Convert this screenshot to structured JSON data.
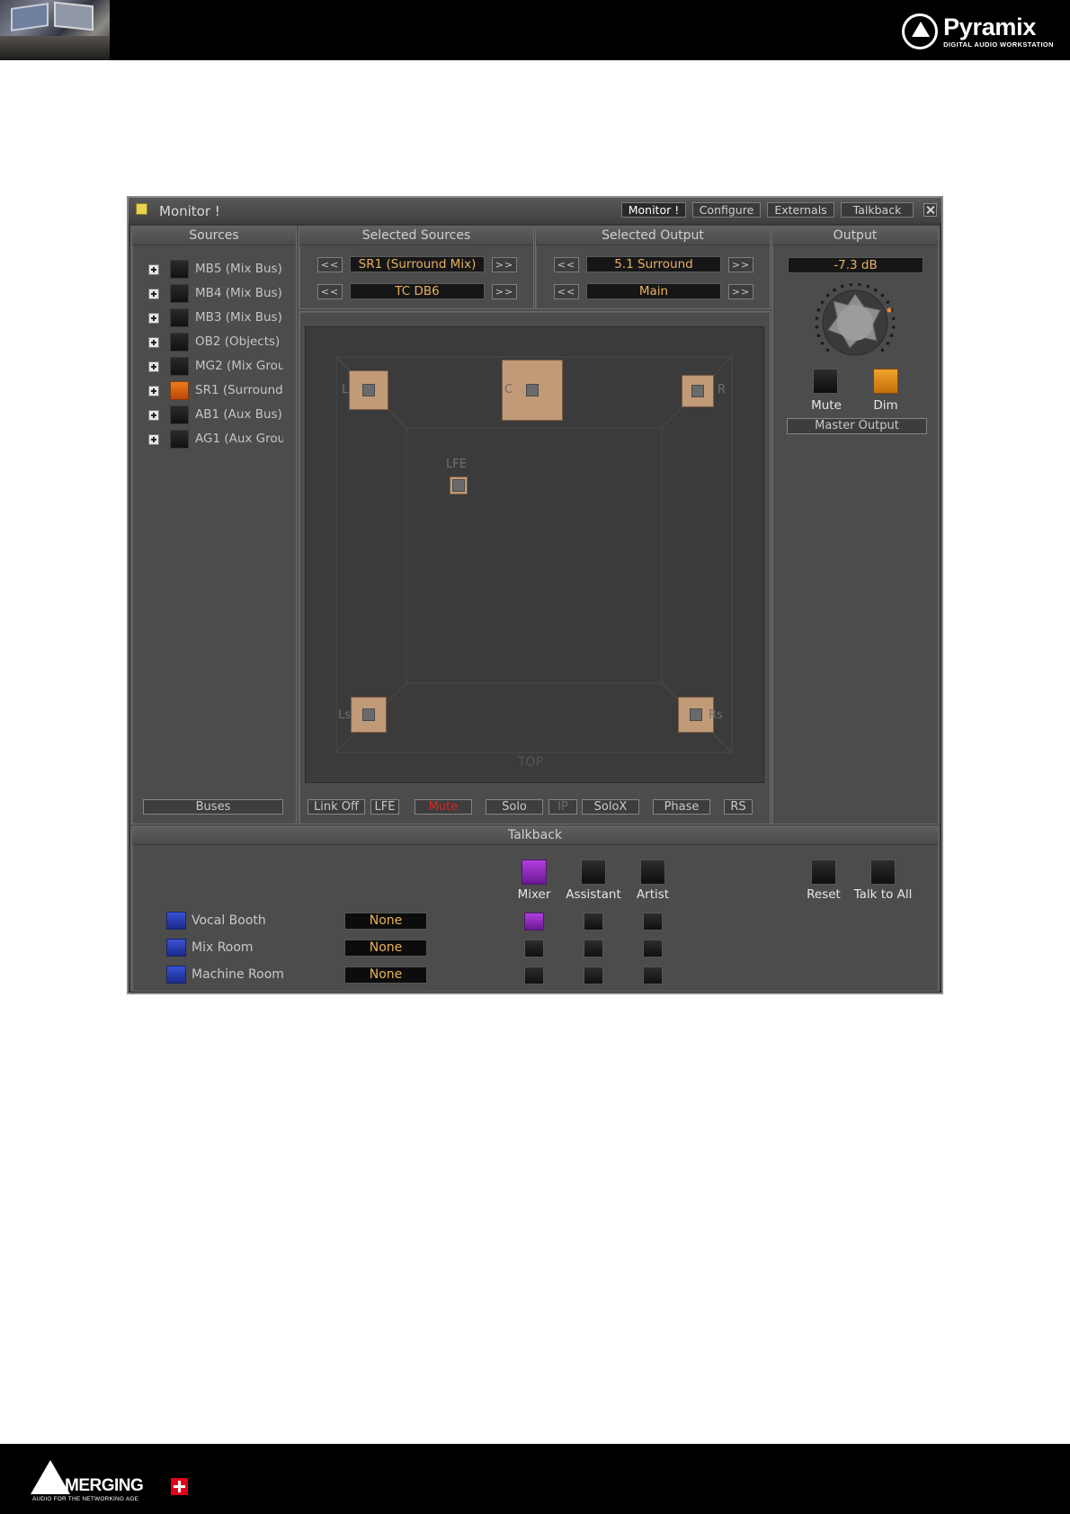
{
  "page": {
    "brand_name": "Pyramix",
    "brand_tagline": "DIGITAL AUDIO WORKSTATION",
    "footer_name": "MERGING",
    "footer_tagline": "AUDIO FOR THE NETWORKING AGE"
  },
  "window": {
    "title": "Monitor !",
    "tabs": [
      "Monitor !",
      "Configure",
      "Externals",
      "Talkback"
    ]
  },
  "sources": {
    "title": "Sources",
    "items": [
      {
        "label": "MB5 (Mix Bus)",
        "active": false
      },
      {
        "label": "MB4 (Mix Bus)",
        "active": false
      },
      {
        "label": "MB3 (Mix Bus)",
        "active": false
      },
      {
        "label": "OB2 (Objects)",
        "active": false
      },
      {
        "label": "MG2 (Mix Grou",
        "active": false
      },
      {
        "label": "SR1 (Surround",
        "active": true
      },
      {
        "label": "AB1 (Aux Bus)",
        "active": false
      },
      {
        "label": "AG1 (Aux Grou",
        "active": false
      }
    ],
    "buses_button": "Buses"
  },
  "selected_sources": {
    "title": "Selected Sources",
    "source": "SR1 (Surround Mix)",
    "secondary": "TC DB6",
    "prev": "<<",
    "next": ">>"
  },
  "selected_output": {
    "title": "Selected Output",
    "format": "5.1 Surround",
    "destination": "Main",
    "prev": "<<",
    "next": ">>"
  },
  "output": {
    "title": "Output",
    "level": "-7.3 dB",
    "mute_label": "Mute",
    "dim_label": "Dim",
    "master_label": "Master Output"
  },
  "surround": {
    "speakers": {
      "L": "L",
      "C": "C",
      "R": "R",
      "LFE": "LFE",
      "Ls": "Ls",
      "Rs": "Rs"
    },
    "top_label": "TOP"
  },
  "bottom_controls": {
    "link": "Link Off",
    "lfe": "LFE",
    "mute": "Mute",
    "solo": "Solo",
    "ip": "IP",
    "solox": "SoloX",
    "phase": "Phase",
    "rs": "RS"
  },
  "talkback": {
    "title": "Talkback",
    "columns": [
      "Mixer",
      "Assistant",
      "Artist"
    ],
    "reset_label": "Reset",
    "talk_all_label": "Talk to All",
    "rows": [
      {
        "label": "Vocal Booth",
        "value": "None"
      },
      {
        "label": "Mix Room",
        "value": "None"
      },
      {
        "label": "Machine Room",
        "value": "None"
      }
    ]
  },
  "colors": {
    "accent_orange": "#f07a1a",
    "dim_orange": "#e89a22",
    "talkback_purple": "#a030d0",
    "room_blue": "#2a3fc0",
    "speaker_tan": "#c19a77"
  }
}
